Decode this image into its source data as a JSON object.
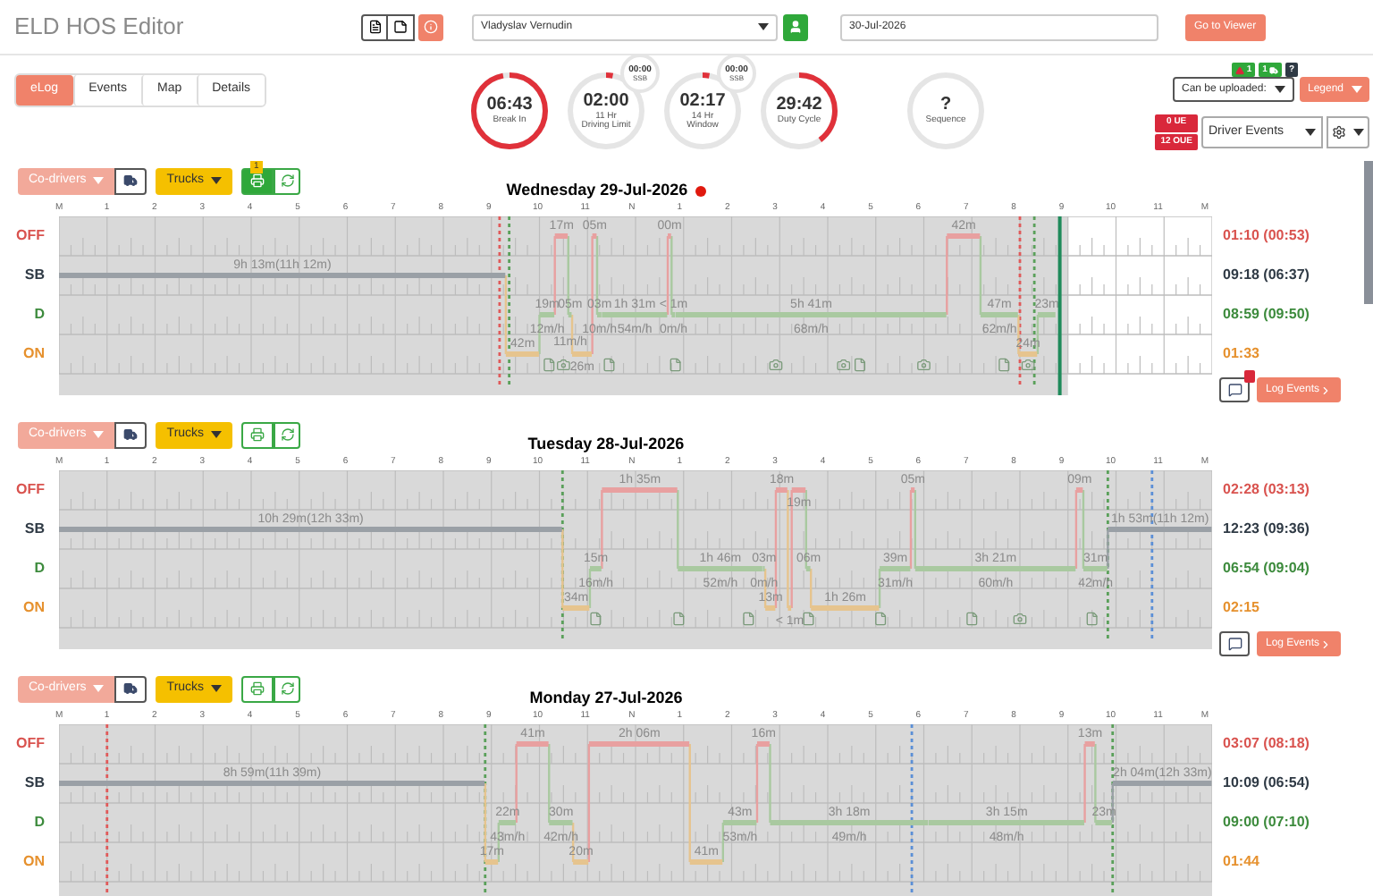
{
  "header": {
    "title": "ELD HOS Editor",
    "driver": "Vladyslav Vernudin",
    "date": "30-Jul-2026",
    "viewer_button": "Go to Viewer"
  },
  "tabs": [
    {
      "label": "eLog",
      "selected": true
    },
    {
      "label": "Events",
      "selected": false
    },
    {
      "label": "Map",
      "selected": false
    },
    {
      "label": "Details",
      "selected": false
    }
  ],
  "gauges": [
    {
      "value": "06:43",
      "label": "Break In"
    },
    {
      "value": "02:00",
      "label": "11 Hr",
      "sublabel": "Driving Limit",
      "mini_value": "00:00",
      "mini_label": "SSB"
    },
    {
      "value": "02:17",
      "label": "14 Hr",
      "sublabel": "Window",
      "mini_value": "00:00",
      "mini_label": "SSB"
    },
    {
      "value": "29:42",
      "label": "Duty Cycle"
    },
    {
      "value": "?",
      "label": "Sequence"
    }
  ],
  "badges": [
    {
      "kind": "warning",
      "text": "1"
    },
    {
      "kind": "truck",
      "text": "1"
    },
    {
      "kind": "help",
      "text": "?"
    }
  ],
  "upload_select": "Can be uploaded:",
  "legend_button": "Legend",
  "counters": [
    "0 UE",
    "12 OUE"
  ],
  "events_select": "Driver Events",
  "days": [
    {
      "title": "Wednesday 29-Jul-2026",
      "rows": [
        {
          "kind": "off_duty",
          "label": "OFF",
          "color": "#d9534f"
        },
        {
          "kind": "sleeper",
          "label": "SB",
          "color": "#2f3a45"
        },
        {
          "kind": "driving",
          "label": "D",
          "color": "#3d8b3d"
        },
        {
          "kind": "on_duty",
          "label": "ON",
          "color": "#e6912e"
        }
      ],
      "alert": true,
      "co_drivers": "Co-drivers",
      "trucks": "Trucks",
      "upload_active": true,
      "upload_count": "1",
      "comment_alert": true,
      "log_events": "Log Events",
      "hours": [
        "M",
        "1",
        "2",
        "3",
        "4",
        "5",
        "6",
        "7",
        "8",
        "9",
        "10",
        "11",
        "N",
        "1",
        "2",
        "3",
        "4",
        "5",
        "6",
        "7",
        "8",
        "9",
        "10",
        "11",
        "M"
      ],
      "segments": [
        {
          "kind": "sleeper",
          "label": "9h 13m(11h 12m)"
        },
        {
          "kind": "on_duty",
          "label": "42m"
        },
        {
          "kind": "driving",
          "label": "19m",
          "speed": "12m/h"
        },
        {
          "kind": "off_duty",
          "label": "17m"
        },
        {
          "kind": "driving",
          "label": "05m",
          "speed": "11m/h"
        },
        {
          "kind": "on_duty",
          "label": "26m"
        },
        {
          "kind": "off_duty",
          "label": "05m"
        },
        {
          "kind": "driving",
          "label": "03m",
          "speed": "10m/h"
        },
        {
          "kind": "driving",
          "label": "1h 31m",
          "speed": "54m/h"
        },
        {
          "kind": "off_duty",
          "label": "00m"
        },
        {
          "kind": "driving",
          "label": "< 1m",
          "speed": "0m/h"
        },
        {
          "kind": "driving",
          "label": "5h 41m",
          "speed": "68m/h"
        },
        {
          "kind": "off_duty",
          "label": "42m"
        },
        {
          "kind": "driving",
          "label": "47m",
          "speed": "62m/h"
        },
        {
          "kind": "on_duty",
          "label": "24m"
        },
        {
          "kind": "driving",
          "label": "23m"
        }
      ],
      "totals": [
        {
          "kind": "off_duty",
          "value": "01:10 (00:53)"
        },
        {
          "kind": "sleeper",
          "value": "09:18 (06:37)"
        },
        {
          "kind": "driving",
          "value": "08:59 (09:50)"
        },
        {
          "kind": "on_duty",
          "value": "01:33"
        }
      ]
    },
    {
      "title": "Tuesday 28-Jul-2026",
      "rows": [
        {
          "kind": "off_duty",
          "label": "OFF",
          "color": "#d9534f"
        },
        {
          "kind": "sleeper",
          "label": "SB",
          "color": "#2f3a45"
        },
        {
          "kind": "driving",
          "label": "D",
          "color": "#3d8b3d"
        },
        {
          "kind": "on_duty",
          "label": "ON",
          "color": "#e6912e"
        }
      ],
      "alert": false,
      "co_drivers": "Co-drivers",
      "trucks": "Trucks",
      "upload_active": false,
      "comment_alert": false,
      "log_events": "Log Events",
      "hours": [
        "M",
        "1",
        "2",
        "3",
        "4",
        "5",
        "6",
        "7",
        "8",
        "9",
        "10",
        "11",
        "N",
        "1",
        "2",
        "3",
        "4",
        "5",
        "6",
        "7",
        "8",
        "9",
        "10",
        "11",
        "M"
      ],
      "segments": [
        {
          "kind": "sleeper",
          "label": "10h 29m(12h 33m)"
        },
        {
          "kind": "on_duty",
          "label": "34m"
        },
        {
          "kind": "driving",
          "label": "15m",
          "speed": "16m/h"
        },
        {
          "kind": "off_duty",
          "label": "1h 35m"
        },
        {
          "kind": "driving",
          "label": "1h 46m",
          "speed": "52m/h"
        },
        {
          "kind": "driving",
          "label": "03m",
          "speed": "0m/h"
        },
        {
          "kind": "on_duty",
          "label": "13m"
        },
        {
          "kind": "off_duty",
          "label": "18m"
        },
        {
          "kind": "on_duty",
          "label": "< 1m"
        },
        {
          "kind": "off_duty",
          "label": "19m"
        },
        {
          "kind": "driving",
          "label": "06m"
        },
        {
          "kind": "on_duty",
          "label": "1h 26m"
        },
        {
          "kind": "driving",
          "label": "39m",
          "speed": "31m/h"
        },
        {
          "kind": "off_duty",
          "label": "05m"
        },
        {
          "kind": "driving",
          "label": "3h 21m",
          "speed": "60m/h"
        },
        {
          "kind": "off_duty",
          "label": "09m"
        },
        {
          "kind": "driving",
          "label": "31m",
          "speed": "42m/h"
        },
        {
          "kind": "sleeper",
          "label": "1h 53m(11h 12m)"
        }
      ],
      "totals": [
        {
          "kind": "off_duty",
          "value": "02:28 (03:13)"
        },
        {
          "kind": "sleeper",
          "value": "12:23 (09:36)"
        },
        {
          "kind": "driving",
          "value": "06:54 (09:04)"
        },
        {
          "kind": "on_duty",
          "value": "02:15"
        }
      ]
    },
    {
      "title": "Monday 27-Jul-2026",
      "rows": [
        {
          "kind": "off_duty",
          "label": "OFF",
          "color": "#d9534f"
        },
        {
          "kind": "sleeper",
          "label": "SB",
          "color": "#2f3a45"
        },
        {
          "kind": "driving",
          "label": "D",
          "color": "#3d8b3d"
        },
        {
          "kind": "on_duty",
          "label": "ON",
          "color": "#e6912e"
        }
      ],
      "alert": false,
      "co_drivers": "Co-drivers",
      "trucks": "Trucks",
      "upload_active": false,
      "hours": [
        "M",
        "1",
        "2",
        "3",
        "4",
        "5",
        "6",
        "7",
        "8",
        "9",
        "10",
        "11",
        "N",
        "1",
        "2",
        "3",
        "4",
        "5",
        "6",
        "7",
        "8",
        "9",
        "10",
        "11",
        "M"
      ],
      "segments": [
        {
          "kind": "sleeper",
          "label": "8h 59m(11h 39m)"
        },
        {
          "kind": "on_duty",
          "label": "17m"
        },
        {
          "kind": "driving",
          "label": "22m",
          "speed": "43m/h"
        },
        {
          "kind": "off_duty",
          "label": "41m"
        },
        {
          "kind": "driving",
          "label": "30m",
          "speed": "42m/h"
        },
        {
          "kind": "on_duty",
          "label": "20m"
        },
        {
          "kind": "off_duty",
          "label": "2h 06m"
        },
        {
          "kind": "on_duty",
          "label": "41m"
        },
        {
          "kind": "driving",
          "label": "43m",
          "speed": "53m/h"
        },
        {
          "kind": "off_duty",
          "label": "16m"
        },
        {
          "kind": "driving",
          "label": "3h 18m",
          "speed": "49m/h"
        },
        {
          "kind": "driving",
          "label": "3h 15m",
          "speed": "48m/h"
        },
        {
          "kind": "off_duty",
          "label": "13m"
        },
        {
          "kind": "driving",
          "label": "23m"
        },
        {
          "kind": "sleeper",
          "label": "2h 04m(12h 33m)"
        }
      ],
      "totals": [
        {
          "kind": "off_duty",
          "value": "03:07 (08:18)"
        },
        {
          "kind": "sleeper",
          "value": "10:09 (06:54)"
        },
        {
          "kind": "driving",
          "value": "09:00 (07:10)"
        },
        {
          "kind": "on_duty",
          "value": "01:44"
        }
      ]
    }
  ]
}
